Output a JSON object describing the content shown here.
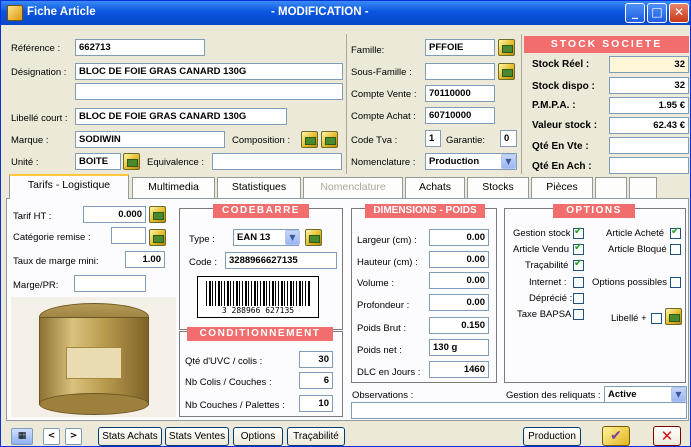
{
  "window": {
    "title": "Fiche Article",
    "mode": "- MODIFICATION -"
  },
  "identity": {
    "reference_label": "Référence :",
    "reference_value": "662713",
    "designation_label": "Désignation :",
    "designation_value": "BLOC DE FOIE GRAS CANARD 130G",
    "designation2_value": "",
    "libelle_court_label": "Libellé court :",
    "libelle_court_value": "BLOC DE FOIE GRAS CANARD 130G",
    "marque_label": "Marque :",
    "marque_value": "SODIWIN",
    "composition_label": "Composition :",
    "unite_label": "Unité :",
    "unite_value": "BOITE",
    "equivalence_label": "Equivalence :",
    "equivalence_value": ""
  },
  "classification": {
    "famille_label": "Famille:",
    "famille_value": "PFFOIE",
    "sous_famille_label": "Sous-Famille :",
    "sous_famille_value": "",
    "compte_vente_label": "Compte Vente :",
    "compte_vente_value": "70110000",
    "compte_achat_label": "Compte Achat :",
    "compte_achat_value": "60710000",
    "code_tva_label": "Code Tva :",
    "code_tva_value": "1",
    "garantie_label": "Garantie:",
    "garantie_value": "0",
    "nomenclature_label": "Nomenclature :",
    "nomenclature_value": "Production"
  },
  "stock": {
    "header": "STOCK SOCIETE",
    "rows": [
      {
        "label": "Stock Réel  :",
        "value": "32"
      },
      {
        "label": "Stock dispo :",
        "value": "32"
      },
      {
        "label": "P.M.P.A.     :",
        "value": "1.95 €"
      },
      {
        "label": "Valeur stock :",
        "value": "62.43 €"
      },
      {
        "label": "Qté En Vte :",
        "value": ""
      },
      {
        "label": "Qté En Ach :",
        "value": ""
      }
    ]
  },
  "tabs": [
    "Tarifs - Logistique",
    "Multimedia",
    "Statistiques",
    "Nomenclature",
    "Achats",
    "Stocks",
    "Pièces"
  ],
  "tarifs": {
    "tarif_ht_label": "Tarif HT :",
    "tarif_ht_value": "0.000",
    "categorie_remise_label": "Catégorie remise :",
    "categorie_remise_value": "",
    "taux_marge_label": "Taux de marge mini:",
    "taux_marge_value": "1.00",
    "marge_pr_label": "Marge/PR:",
    "marge_pr_value": ""
  },
  "codebarre": {
    "header": "CODEBARRE",
    "type_label": "Type :",
    "type_value": "EAN 13",
    "code_label": "Code :",
    "code_value": "3288966627135",
    "barcode_text": "3 288966 627135"
  },
  "conditionnement": {
    "header": "CONDITIONNEMENT",
    "rows": [
      {
        "label": "Qté d'UVC / colis :",
        "value": "30"
      },
      {
        "label": "Nb Colis / Couches :",
        "value": "6"
      },
      {
        "label": "Nb Couches / Palettes :",
        "value": "10"
      }
    ]
  },
  "dimensions": {
    "header": "DIMENSIONS - POIDS",
    "rows": [
      {
        "label": "Largeur  (cm) :",
        "value": "0.00"
      },
      {
        "label": "Hauteur  (cm) :",
        "value": "0.00"
      },
      {
        "label": "Volume   :",
        "value": "0.00"
      },
      {
        "label": "Profondeur :",
        "value": "0.00"
      }
    ],
    "poids_brut_label": "Poids Brut :",
    "poids_brut_value": "0.150",
    "poids_net_label": "Poids net :",
    "poids_net_value": "130 g",
    "dlc_label": "DLC en Jours :",
    "dlc_value": "1460"
  },
  "options": {
    "header": "OPTIONS",
    "gestion_stock": "Gestion stock",
    "article_vendu": "Article Vendu",
    "tracabilite": "Traçabilité",
    "internet": "Internet :",
    "deprecie": "Déprécié :",
    "taxe_bapsa": "Taxe BAPSA",
    "article_achete": "Article Acheté",
    "article_bloque": "Article Bloqué",
    "options_possibles": "Options possibles",
    "libelle_plus": "Libellé +"
  },
  "observations_label": "Observations :",
  "observations_value": "",
  "reliquats_label": "Gestion des reliquats :",
  "reliquats_value": "Active",
  "bottom": {
    "nav_prev": "<",
    "nav_next": ">",
    "stats_achats": "Stats Achats",
    "stats_ventes": "Stats Ventes",
    "options": "Options",
    "tracabilite": "Traçabilité",
    "production": "Production"
  }
}
